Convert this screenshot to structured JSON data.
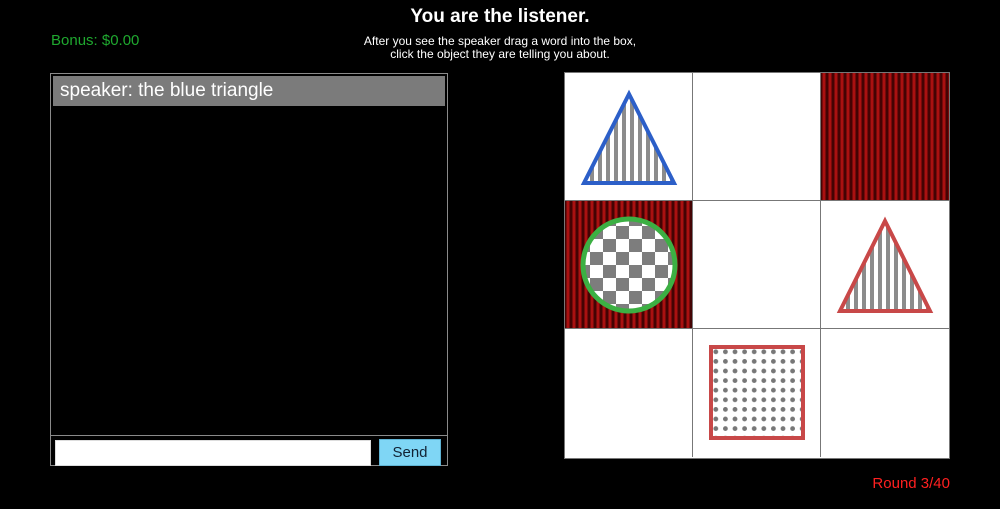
{
  "header": {
    "title": "You are the listener.",
    "instructions_line1": "After you see the speaker drag a word into the box,",
    "instructions_line2": "click the object they are telling you about."
  },
  "bonus": {
    "label": "Bonus: $0.00",
    "color": "#1fa82f"
  },
  "chat": {
    "messages": [
      {
        "text": "speaker: the blue triangle"
      }
    ],
    "input_value": "",
    "send_label": "Send"
  },
  "grid": {
    "rows": 3,
    "cols": 3,
    "cells": [
      {
        "row": 0,
        "col": 0,
        "background": "white",
        "object": {
          "shape": "triangle",
          "pattern": "vertical-stripes",
          "border_color": "#2c5fc8"
        }
      },
      {
        "row": 0,
        "col": 1,
        "background": "white",
        "object": null
      },
      {
        "row": 0,
        "col": 2,
        "background": "red-curtain",
        "object": null
      },
      {
        "row": 1,
        "col": 0,
        "background": "red-curtain",
        "object": {
          "shape": "circle",
          "pattern": "checkerboard",
          "border_color": "#3cb043"
        }
      },
      {
        "row": 1,
        "col": 1,
        "background": "white",
        "object": null
      },
      {
        "row": 1,
        "col": 2,
        "background": "white",
        "object": {
          "shape": "triangle",
          "pattern": "vertical-stripes",
          "border_color": "#c84848"
        }
      },
      {
        "row": 2,
        "col": 0,
        "background": "white",
        "object": null
      },
      {
        "row": 2,
        "col": 1,
        "background": "white",
        "object": {
          "shape": "square",
          "pattern": "dots",
          "border_color": "#c84848"
        }
      },
      {
        "row": 2,
        "col": 2,
        "background": "white",
        "object": null
      }
    ]
  },
  "round": {
    "label": "Round 3/40",
    "color": "#ff2020"
  }
}
